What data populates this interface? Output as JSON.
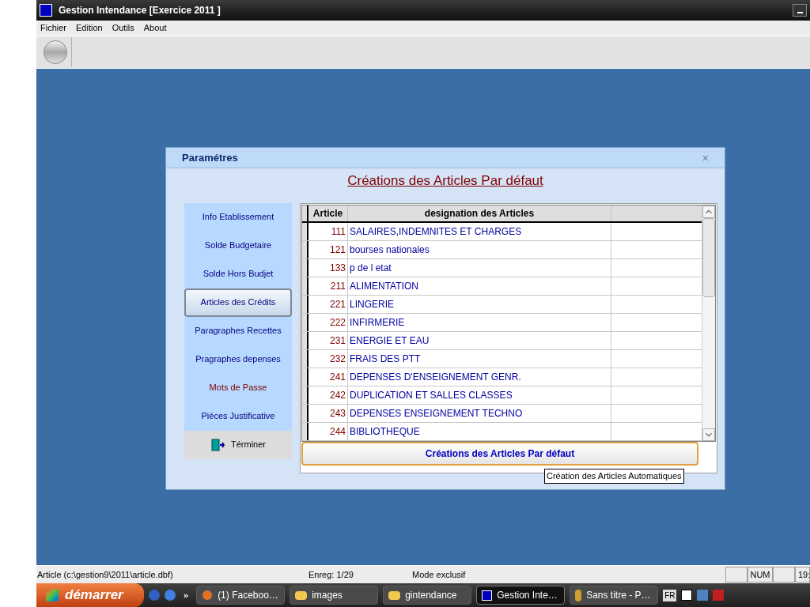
{
  "window": {
    "title": "Gestion Intendance [Exercice  2011 ]"
  },
  "menu": [
    "Fichier",
    "Edition",
    "Outils",
    "About"
  ],
  "dialog": {
    "title": "Paramétres",
    "close": "×",
    "heading": "Créations des Articles Par défaut",
    "sidebar": [
      {
        "label": "Info  Etablissement",
        "kind": "nav",
        "selected": false,
        "color": "#000080"
      },
      {
        "label": "Solde  Budgetaire",
        "kind": "nav",
        "selected": false,
        "color": "#000080"
      },
      {
        "label": "Solde  Hors  Budjet",
        "kind": "nav",
        "selected": false,
        "color": "#000080"
      },
      {
        "label": "Articles des Crédits",
        "kind": "nav",
        "selected": true,
        "color": "#000080"
      },
      {
        "label": "Paragraphes Recettes",
        "kind": "nav",
        "selected": false,
        "color": "#000080"
      },
      {
        "label": "Pragraphes  depenses",
        "kind": "nav",
        "selected": false,
        "color": "#000080"
      },
      {
        "label": "Mots de Passe",
        "kind": "nav",
        "selected": false,
        "color": "#800000"
      },
      {
        "label": "Piéces Justificative",
        "kind": "nav",
        "selected": false,
        "color": "#000080"
      },
      {
        "label": "Términer",
        "kind": "exit",
        "selected": false,
        "color": "#000000"
      }
    ],
    "table": {
      "columns": [
        "Article",
        "designation  des Articles"
      ],
      "rows": [
        [
          "111",
          "SALAIRES,INDEMNITES ET CHARGES"
        ],
        [
          "121",
          "bourses nationales"
        ],
        [
          "133",
          "p de l etat"
        ],
        [
          "211",
          "ALIMENTATION"
        ],
        [
          "221",
          "LINGERIE"
        ],
        [
          "222",
          "INFIRMERIE"
        ],
        [
          "231",
          "ENERGIE ET EAU"
        ],
        [
          "232",
          "FRAIS DES PTT"
        ],
        [
          "241",
          "DEPENSES D'ENSEIGNEMENT GENR."
        ],
        [
          "242",
          "DUPLICATION ET SALLES CLASSES"
        ],
        [
          "243",
          "DEPENSES ENSEIGNEMENT TECHNO"
        ],
        [
          "244",
          "BIBLIOTHEQUE"
        ]
      ]
    },
    "button": "Créations des Articles  Par défaut",
    "tooltip": "Création  des Articles Automatiques"
  },
  "status_bar": [
    "Article (c:\\gestion9\\2011\\article.dbf)",
    "Enreg: 1/29",
    "Mode exclusif",
    "NUM",
    "19:"
  ],
  "taskbar": {
    "start": "démarrer",
    "more": "»",
    "items": [
      {
        "label": "(1) Faceboo…",
        "kind": "browser",
        "selected": false
      },
      {
        "label": "images",
        "kind": "folder",
        "selected": false
      },
      {
        "label": "gintendance",
        "kind": "folder",
        "selected": false
      },
      {
        "label": "Gestion Inte…",
        "kind": "app",
        "selected": true
      },
      {
        "label": "Sans titre - P…",
        "kind": "paint",
        "selected": false
      }
    ],
    "tray": {
      "lang": "FR"
    }
  }
}
